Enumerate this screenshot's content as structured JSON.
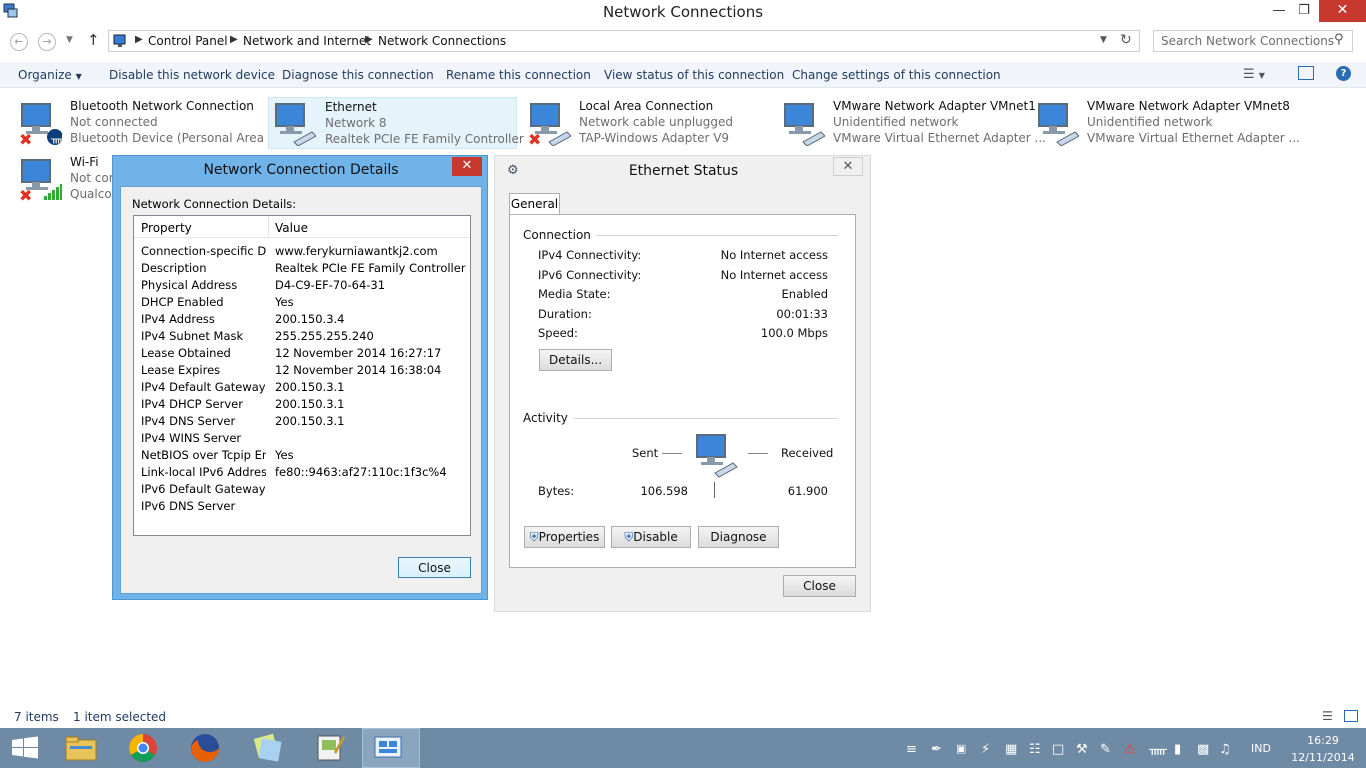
{
  "window": {
    "title": "Network Connections"
  },
  "address": {
    "crumbs": [
      "Control Panel",
      "Network and Internet",
      "Network Connections"
    ],
    "search_placeholder": "Search Network Connections"
  },
  "commands": {
    "organize": "Organize",
    "disable": "Disable this network device",
    "diagnose": "Diagnose this connection",
    "rename": "Rename this connection",
    "view_status": "View status of this connection",
    "change_settings": "Change settings of this connection"
  },
  "items": [
    {
      "name": "Bluetooth Network Connection",
      "line2": "Not connected",
      "line3": "Bluetooth Device (Personal Area ..."
    },
    {
      "name": "Ethernet",
      "line2": "Network  8",
      "line3": "Realtek PCIe FE Family Controller"
    },
    {
      "name": "Local Area Connection",
      "line2": "Network cable unplugged",
      "line3": "TAP-Windows Adapter V9"
    },
    {
      "name": "VMware Network Adapter VMnet1",
      "line2": "Unidentified network",
      "line3": "VMware Virtual Ethernet Adapter ..."
    },
    {
      "name": "VMware Network Adapter VMnet8",
      "line2": "Unidentified network",
      "line3": "VMware Virtual Ethernet Adapter ..."
    },
    {
      "name": "Wi-Fi",
      "line2": "Not con",
      "line3": "Qualco"
    }
  ],
  "details": {
    "title": "Network Connection Details",
    "label": "Network Connection Details:",
    "col_property": "Property",
    "col_value": "Value",
    "rows": [
      [
        "Connection-specific DN...",
        "www.ferykurniawantkj2.com"
      ],
      [
        "Description",
        "Realtek PCIe FE Family Controller"
      ],
      [
        "Physical Address",
        "D4-C9-EF-70-64-31"
      ],
      [
        "DHCP Enabled",
        "Yes"
      ],
      [
        "IPv4 Address",
        "200.150.3.4"
      ],
      [
        "IPv4 Subnet Mask",
        "255.255.255.240"
      ],
      [
        "Lease Obtained",
        "12 November 2014 16:27:17"
      ],
      [
        "Lease Expires",
        "12 November 2014 16:38:04"
      ],
      [
        "IPv4 Default Gateway",
        "200.150.3.1"
      ],
      [
        "IPv4 DHCP Server",
        "200.150.3.1"
      ],
      [
        "IPv4 DNS Server",
        "200.150.3.1"
      ],
      [
        "IPv4 WINS Server",
        ""
      ],
      [
        "NetBIOS over Tcpip En...",
        "Yes"
      ],
      [
        "Link-local IPv6 Address",
        "fe80::9463:af27:110c:1f3c%4"
      ],
      [
        "IPv6 Default Gateway",
        ""
      ],
      [
        "IPv6 DNS Server",
        ""
      ]
    ],
    "close": "Close"
  },
  "status": {
    "title": "Ethernet Status",
    "tab": "General",
    "connection": "Connection",
    "ipv4_label": "IPv4 Connectivity:",
    "ipv4": "No Internet access",
    "ipv6_label": "IPv6 Connectivity:",
    "ipv6": "No Internet access",
    "media_label": "Media State:",
    "media": "Enabled",
    "duration_label": "Duration:",
    "duration": "00:01:33",
    "speed_label": "Speed:",
    "speed": "100.0 Mbps",
    "details_btn": "Details...",
    "activity": "Activity",
    "sent": "Sent",
    "received": "Received",
    "bytes_label": "Bytes:",
    "bytes_sent": "106.598",
    "bytes_received": "61.900",
    "properties": "Properties",
    "disable": "Disable",
    "diagnose": "Diagnose",
    "close": "Close"
  },
  "statusbar": {
    "items": "7 items",
    "selected": "1 item selected"
  },
  "tray": {
    "lang": "IND",
    "time": "16:29",
    "date": "12/11/2014"
  }
}
